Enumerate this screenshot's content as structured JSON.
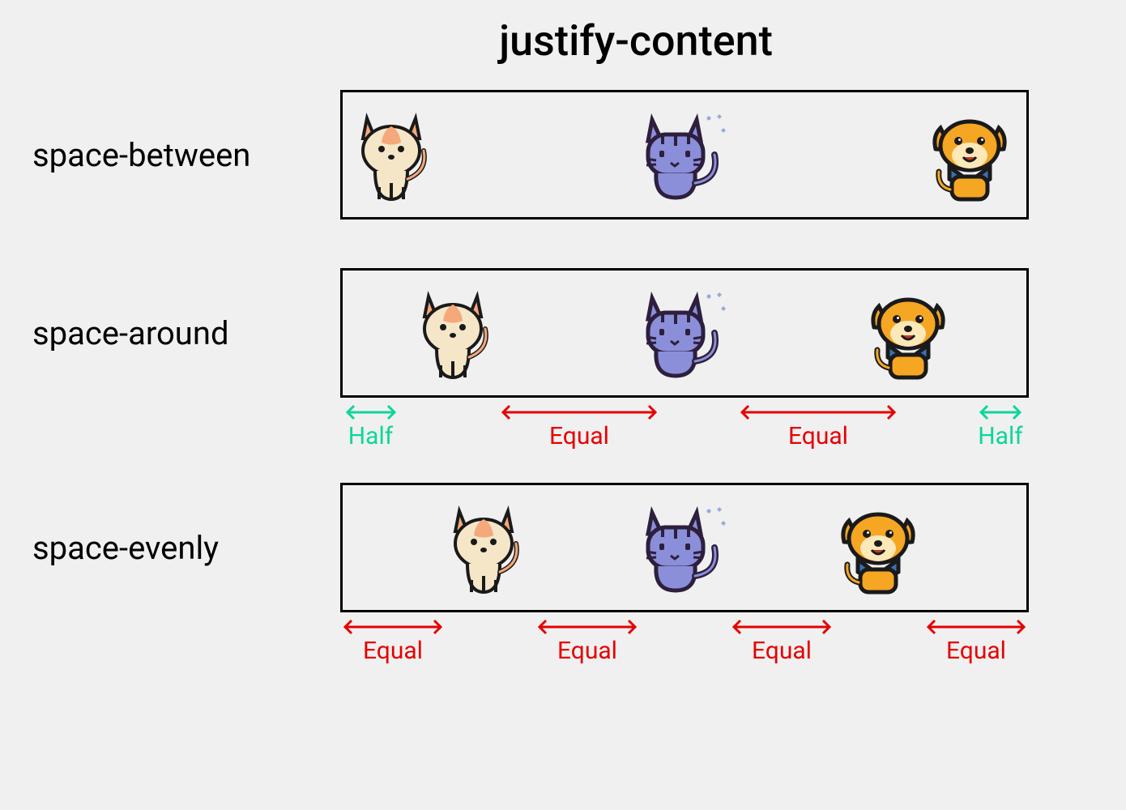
{
  "title": "justify-content",
  "rows": [
    {
      "label": "space-between",
      "mode": "between"
    },
    {
      "label": "space-around",
      "mode": "around"
    },
    {
      "label": "space-evenly",
      "mode": "evenly"
    }
  ],
  "annotations": {
    "half": "Half",
    "equal": "Equal"
  },
  "pets": [
    "cat-cream",
    "cat-purple",
    "dog-orange"
  ]
}
